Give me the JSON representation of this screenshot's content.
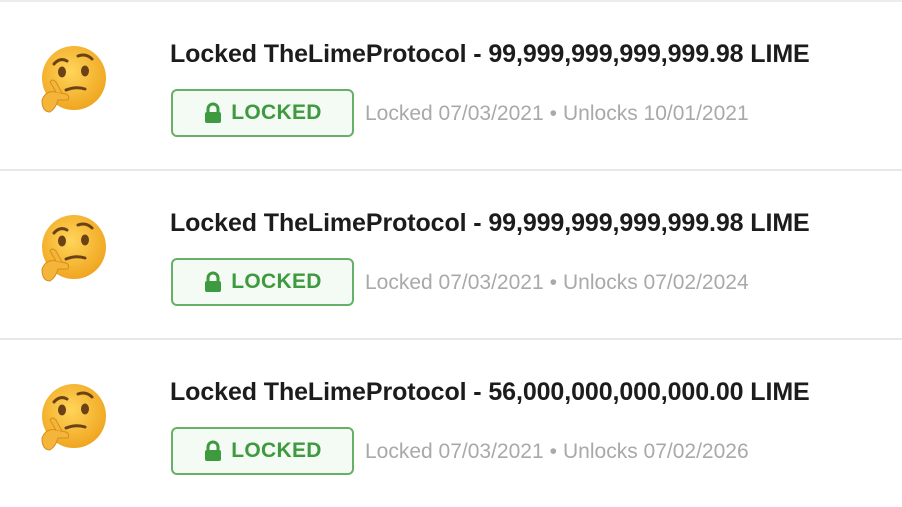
{
  "colors": {
    "badge_border": "#67b067",
    "badge_text": "#3e9a3e",
    "badge_bg": "#f4faf4",
    "meta_text": "#a9a9a9",
    "title_text": "#1c1c1c"
  },
  "locks": [
    {
      "avatar_icon": "thinking-face-icon",
      "title": "Locked TheLimeProtocol - 99,999,999,999,999.98 LIME",
      "badge_label": "LOCKED",
      "locked_text": "Locked 07/03/2021",
      "separator": "•",
      "unlocks_text": "Unlocks 10/01/2021"
    },
    {
      "avatar_icon": "thinking-face-icon",
      "title": "Locked TheLimeProtocol - 99,999,999,999,999.98 LIME",
      "badge_label": "LOCKED",
      "locked_text": "Locked 07/03/2021",
      "separator": "•",
      "unlocks_text": "Unlocks 07/02/2024"
    },
    {
      "avatar_icon": "thinking-face-icon",
      "title": "Locked TheLimeProtocol - 56,000,000,000,000.00 LIME",
      "badge_label": "LOCKED",
      "locked_text": "Locked 07/03/2021",
      "separator": "•",
      "unlocks_text": "Unlocks 07/02/2026"
    }
  ]
}
